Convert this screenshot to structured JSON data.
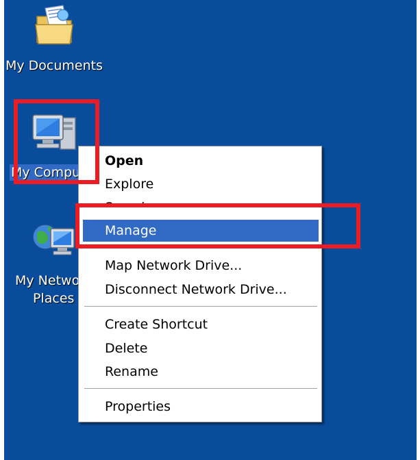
{
  "desktop": {
    "background": "#0a4c9c",
    "icons": [
      {
        "label": "My Documents",
        "icon": "folder-documents-icon"
      },
      {
        "label": "My Compu",
        "icon": "my-computer-icon",
        "selected": true
      },
      {
        "label_line1": "My Netwo",
        "label_line2": "Places",
        "icon": "network-places-icon"
      }
    ]
  },
  "context_menu": {
    "items": [
      {
        "label": "Open",
        "bold": true
      },
      {
        "label": "Explore"
      },
      {
        "label": "Search..."
      },
      {
        "label": "Manage",
        "highlighted": true
      },
      {
        "label": "Map Network Drive..."
      },
      {
        "label": "Disconnect Network Drive..."
      },
      {
        "label": "Create Shortcut"
      },
      {
        "label": "Delete"
      },
      {
        "label": "Rename"
      },
      {
        "label": "Properties"
      }
    ],
    "highlight_color": "#316ac5"
  },
  "annotations": {
    "box_color": "#ec1c24"
  }
}
